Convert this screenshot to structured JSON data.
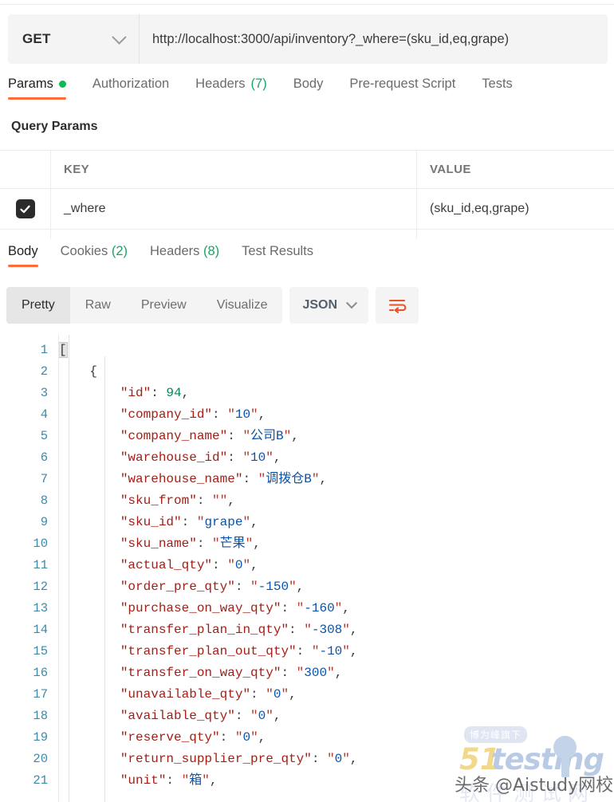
{
  "request": {
    "method": "GET",
    "url": "http://localhost:3000/api/inventory?_where=(sku_id,eq,grape)",
    "tabs": [
      {
        "label": "Params",
        "badge": "dot",
        "active": true
      },
      {
        "label": "Authorization",
        "badge": "",
        "active": false
      },
      {
        "label": "Headers",
        "count": "(7)",
        "active": false
      },
      {
        "label": "Body",
        "badge": "",
        "active": false
      },
      {
        "label": "Pre-request Script",
        "badge": "",
        "active": false
      },
      {
        "label": "Tests",
        "badge": "",
        "active": false
      }
    ]
  },
  "query_params": {
    "section_title": "Query Params",
    "columns": {
      "key": "KEY",
      "value": "VALUE"
    },
    "rows": [
      {
        "checked": true,
        "key": "_where",
        "value": "(sku_id,eq,grape)"
      }
    ]
  },
  "response": {
    "tabs": [
      {
        "label": "Body",
        "count": "",
        "active": true
      },
      {
        "label": "Cookies",
        "count": "(2)",
        "active": false
      },
      {
        "label": "Headers",
        "count": "(8)",
        "active": false
      },
      {
        "label": "Test Results",
        "count": "",
        "active": false
      }
    ],
    "view_modes": [
      {
        "label": "Pretty",
        "active": true
      },
      {
        "label": "Raw",
        "active": false
      },
      {
        "label": "Preview",
        "active": false
      },
      {
        "label": "Visualize",
        "active": false
      }
    ],
    "format": "JSON",
    "wrap_icon": "word-wrap-icon"
  },
  "code": {
    "lines": [
      {
        "num": "1",
        "segments": [
          {
            "t": "[",
            "c": "p brk-hl"
          }
        ]
      },
      {
        "num": "2",
        "segments": [
          {
            "t": "    ",
            "c": "p"
          },
          {
            "t": "{",
            "c": "p"
          }
        ]
      },
      {
        "num": "3",
        "segments": [
          {
            "t": "        ",
            "c": "p"
          },
          {
            "t": "\"id\"",
            "c": "k"
          },
          {
            "t": ": ",
            "c": "p"
          },
          {
            "t": "94",
            "c": "n"
          },
          {
            "t": ",",
            "c": "p"
          }
        ]
      },
      {
        "num": "4",
        "segments": [
          {
            "t": "        ",
            "c": "p"
          },
          {
            "t": "\"company_id\"",
            "c": "k"
          },
          {
            "t": ": ",
            "c": "p"
          },
          {
            "t": "\"",
            "c": "q"
          },
          {
            "t": "10",
            "c": "s"
          },
          {
            "t": "\"",
            "c": "q"
          },
          {
            "t": ",",
            "c": "p"
          }
        ]
      },
      {
        "num": "5",
        "segments": [
          {
            "t": "        ",
            "c": "p"
          },
          {
            "t": "\"company_name\"",
            "c": "k"
          },
          {
            "t": ": ",
            "c": "p"
          },
          {
            "t": "\"",
            "c": "q"
          },
          {
            "t": "公司B",
            "c": "s"
          },
          {
            "t": "\"",
            "c": "q"
          },
          {
            "t": ",",
            "c": "p"
          }
        ]
      },
      {
        "num": "6",
        "segments": [
          {
            "t": "        ",
            "c": "p"
          },
          {
            "t": "\"warehouse_id\"",
            "c": "k"
          },
          {
            "t": ": ",
            "c": "p"
          },
          {
            "t": "\"",
            "c": "q"
          },
          {
            "t": "10",
            "c": "s"
          },
          {
            "t": "\"",
            "c": "q"
          },
          {
            "t": ",",
            "c": "p"
          }
        ]
      },
      {
        "num": "7",
        "segments": [
          {
            "t": "        ",
            "c": "p"
          },
          {
            "t": "\"warehouse_name\"",
            "c": "k"
          },
          {
            "t": ": ",
            "c": "p"
          },
          {
            "t": "\"",
            "c": "q"
          },
          {
            "t": "调拨仓B",
            "c": "s"
          },
          {
            "t": "\"",
            "c": "q"
          },
          {
            "t": ",",
            "c": "p"
          }
        ]
      },
      {
        "num": "8",
        "segments": [
          {
            "t": "        ",
            "c": "p"
          },
          {
            "t": "\"sku_from\"",
            "c": "k"
          },
          {
            "t": ": ",
            "c": "p"
          },
          {
            "t": "\"\"",
            "c": "q"
          },
          {
            "t": ",",
            "c": "p"
          }
        ]
      },
      {
        "num": "9",
        "segments": [
          {
            "t": "        ",
            "c": "p"
          },
          {
            "t": "\"sku_id\"",
            "c": "k"
          },
          {
            "t": ": ",
            "c": "p"
          },
          {
            "t": "\"",
            "c": "q"
          },
          {
            "t": "grape",
            "c": "s"
          },
          {
            "t": "\"",
            "c": "q"
          },
          {
            "t": ",",
            "c": "p"
          }
        ]
      },
      {
        "num": "10",
        "segments": [
          {
            "t": "        ",
            "c": "p"
          },
          {
            "t": "\"sku_name\"",
            "c": "k"
          },
          {
            "t": ": ",
            "c": "p"
          },
          {
            "t": "\"",
            "c": "q"
          },
          {
            "t": "芒果",
            "c": "s"
          },
          {
            "t": "\"",
            "c": "q"
          },
          {
            "t": ",",
            "c": "p"
          }
        ]
      },
      {
        "num": "11",
        "segments": [
          {
            "t": "        ",
            "c": "p"
          },
          {
            "t": "\"actual_qty\"",
            "c": "k"
          },
          {
            "t": ": ",
            "c": "p"
          },
          {
            "t": "\"",
            "c": "q"
          },
          {
            "t": "0",
            "c": "s"
          },
          {
            "t": "\"",
            "c": "q"
          },
          {
            "t": ",",
            "c": "p"
          }
        ]
      },
      {
        "num": "12",
        "segments": [
          {
            "t": "        ",
            "c": "p"
          },
          {
            "t": "\"order_pre_qty\"",
            "c": "k"
          },
          {
            "t": ": ",
            "c": "p"
          },
          {
            "t": "\"",
            "c": "q"
          },
          {
            "t": "-150",
            "c": "s"
          },
          {
            "t": "\"",
            "c": "q"
          },
          {
            "t": ",",
            "c": "p"
          }
        ]
      },
      {
        "num": "13",
        "segments": [
          {
            "t": "        ",
            "c": "p"
          },
          {
            "t": "\"purchase_on_way_qty\"",
            "c": "k"
          },
          {
            "t": ": ",
            "c": "p"
          },
          {
            "t": "\"",
            "c": "q"
          },
          {
            "t": "-160",
            "c": "s"
          },
          {
            "t": "\"",
            "c": "q"
          },
          {
            "t": ",",
            "c": "p"
          }
        ]
      },
      {
        "num": "14",
        "segments": [
          {
            "t": "        ",
            "c": "p"
          },
          {
            "t": "\"transfer_plan_in_qty\"",
            "c": "k"
          },
          {
            "t": ": ",
            "c": "p"
          },
          {
            "t": "\"",
            "c": "q"
          },
          {
            "t": "-308",
            "c": "s"
          },
          {
            "t": "\"",
            "c": "q"
          },
          {
            "t": ",",
            "c": "p"
          }
        ]
      },
      {
        "num": "15",
        "segments": [
          {
            "t": "        ",
            "c": "p"
          },
          {
            "t": "\"transfer_plan_out_qty\"",
            "c": "k"
          },
          {
            "t": ": ",
            "c": "p"
          },
          {
            "t": "\"",
            "c": "q"
          },
          {
            "t": "-10",
            "c": "s"
          },
          {
            "t": "\"",
            "c": "q"
          },
          {
            "t": ",",
            "c": "p"
          }
        ]
      },
      {
        "num": "16",
        "segments": [
          {
            "t": "        ",
            "c": "p"
          },
          {
            "t": "\"transfer_on_way_qty\"",
            "c": "k"
          },
          {
            "t": ": ",
            "c": "p"
          },
          {
            "t": "\"",
            "c": "q"
          },
          {
            "t": "300",
            "c": "s"
          },
          {
            "t": "\"",
            "c": "q"
          },
          {
            "t": ",",
            "c": "p"
          }
        ]
      },
      {
        "num": "17",
        "segments": [
          {
            "t": "        ",
            "c": "p"
          },
          {
            "t": "\"unavailable_qty\"",
            "c": "k"
          },
          {
            "t": ": ",
            "c": "p"
          },
          {
            "t": "\"",
            "c": "q"
          },
          {
            "t": "0",
            "c": "s"
          },
          {
            "t": "\"",
            "c": "q"
          },
          {
            "t": ",",
            "c": "p"
          }
        ]
      },
      {
        "num": "18",
        "segments": [
          {
            "t": "        ",
            "c": "p"
          },
          {
            "t": "\"available_qty\"",
            "c": "k"
          },
          {
            "t": ": ",
            "c": "p"
          },
          {
            "t": "\"",
            "c": "q"
          },
          {
            "t": "0",
            "c": "s"
          },
          {
            "t": "\"",
            "c": "q"
          },
          {
            "t": ",",
            "c": "p"
          }
        ]
      },
      {
        "num": "19",
        "segments": [
          {
            "t": "        ",
            "c": "p"
          },
          {
            "t": "\"reserve_qty\"",
            "c": "k"
          },
          {
            "t": ": ",
            "c": "p"
          },
          {
            "t": "\"",
            "c": "q"
          },
          {
            "t": "0",
            "c": "s"
          },
          {
            "t": "\"",
            "c": "q"
          },
          {
            "t": ",",
            "c": "p"
          }
        ]
      },
      {
        "num": "20",
        "segments": [
          {
            "t": "        ",
            "c": "p"
          },
          {
            "t": "\"return_supplier_pre_qty\"",
            "c": "k"
          },
          {
            "t": ": ",
            "c": "p"
          },
          {
            "t": "\"",
            "c": "q"
          },
          {
            "t": "0",
            "c": "s"
          },
          {
            "t": "\"",
            "c": "q"
          },
          {
            "t": ",",
            "c": "p"
          }
        ]
      },
      {
        "num": "21",
        "segments": [
          {
            "t": "        ",
            "c": "p"
          },
          {
            "t": "\"unit\"",
            "c": "k"
          },
          {
            "t": ": ",
            "c": "p"
          },
          {
            "t": "\"",
            "c": "q"
          },
          {
            "t": "箱",
            "c": "s"
          },
          {
            "t": "\"",
            "c": "q"
          },
          {
            "t": ",",
            "c": "p"
          }
        ]
      }
    ]
  },
  "watermark": {
    "badge": "博为峰旗下",
    "logo_num": "51",
    "logo_word": "testing",
    "subtitle": "软件测试网",
    "overlay": "头条 @Aistudy网校"
  }
}
